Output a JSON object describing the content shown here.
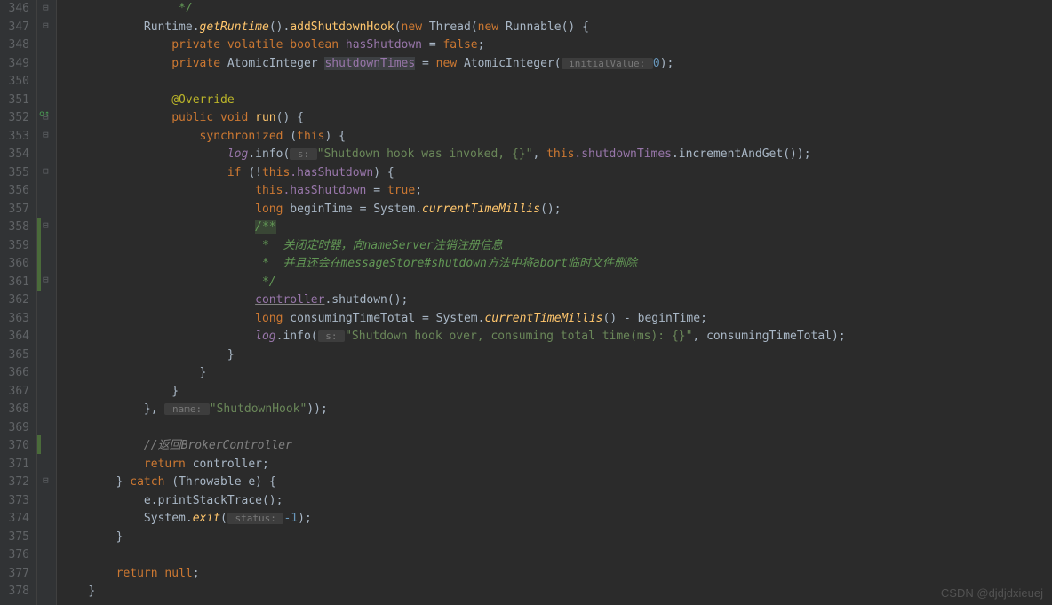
{
  "watermark": "CSDN @djdjdxieuej",
  "gutter": {
    "start": 346,
    "end": 378
  },
  "code": {
    "l346": {
      "indent": "                ",
      "c1": " */"
    },
    "l347": {
      "indent": "            ",
      "cls": "Runtime",
      "m1": "getRuntime",
      "m2": "addShutdownHook",
      "kw1": "new",
      "cls2": "Thread",
      "kw2": "new",
      "cls3": "Runnable",
      "end": "() {"
    },
    "l348": {
      "indent": "                ",
      "kw": "private volatile boolean ",
      "field": "hasShutdown",
      "op": " = ",
      "val": "false",
      "end": ";"
    },
    "l349": {
      "indent": "                ",
      "kw": "private ",
      "type": "AtomicInteger ",
      "field": "shutdownTimes",
      "op": " = ",
      "kw2": "new ",
      "cls": "AtomicInteger(",
      "hint": " initialValue: ",
      "val": "0",
      "end": ");"
    },
    "l350": {
      "indent": ""
    },
    "l351": {
      "indent": "                ",
      "annotation": "@Override"
    },
    "l352": {
      "indent": "                ",
      "kw": "public void ",
      "method": "run",
      "end": "() {"
    },
    "l353": {
      "indent": "                    ",
      "kw": "synchronized ",
      "p1": "(",
      "kw2": "this",
      "p2": ") {"
    },
    "l354": {
      "indent": "                        ",
      "var": "log",
      "m": ".info(",
      "hint": " s: ",
      "str": "\"Shutdown hook was invoked, {}\"",
      "c": ", ",
      "kw": "this",
      "f": ".shutdownTimes",
      "m2": ".incrementAndGet());"
    },
    "l355": {
      "indent": "                        ",
      "kw": "if ",
      "p1": "(!",
      "kw2": "this",
      "f": ".hasShutdown",
      "p2": ") {"
    },
    "l356": {
      "indent": "                            ",
      "kw": "this",
      "f": ".hasShutdown",
      "op": " = ",
      "val": "true",
      "end": ";"
    },
    "l357": {
      "indent": "                            ",
      "kw": "long ",
      "var": "beginTime = System.",
      "m": "currentTimeMillis",
      "end": "();"
    },
    "l358": {
      "indent": "                            ",
      "c": "/**"
    },
    "l359": {
      "indent": "                            ",
      "c": " *  关闭定时器，向nameServer注销注册信息"
    },
    "l360": {
      "indent": "                            ",
      "c": " *  并且还会在messageStore#shutdown方法中将abort临时文件删除"
    },
    "l361": {
      "indent": "                            ",
      "c": " */"
    },
    "l362": {
      "indent": "                            ",
      "var": "controller",
      "m": ".shutdown();"
    },
    "l363": {
      "indent": "                            ",
      "kw": "long ",
      "var": "consumingTimeTotal = System.",
      "m": "currentTimeMillis",
      "mid": "() - beginTime;"
    },
    "l364": {
      "indent": "                            ",
      "var": "log",
      "m": ".info(",
      "hint": " s: ",
      "str": "\"Shutdown hook over, consuming total time(ms): {}\"",
      "c": ", consumingTimeTotal);"
    },
    "l365": {
      "indent": "                        ",
      "c": "}"
    },
    "l366": {
      "indent": "                    ",
      "c": "}"
    },
    "l367": {
      "indent": "                ",
      "c": "}"
    },
    "l368": {
      "indent": "            ",
      "c": "}, ",
      "hint": " name: ",
      "str": "\"ShutdownHook\"",
      "end": "));"
    },
    "l369": {
      "indent": ""
    },
    "l370": {
      "indent": "            ",
      "c": "//返回BrokerController"
    },
    "l371": {
      "indent": "            ",
      "kw": "return ",
      "var": "controller;"
    },
    "l372": {
      "indent": "        ",
      "c1": "} ",
      "kw": "catch ",
      "c2": "(Throwable e) {"
    },
    "l373": {
      "indent": "            ",
      "c": "e.printStackTrace();"
    },
    "l374": {
      "indent": "            ",
      "cls": "System.",
      "m": "exit",
      "p": "(",
      "hint": " status: ",
      "val": "-1",
      "end": ");"
    },
    "l375": {
      "indent": "        ",
      "c": "}"
    },
    "l376": {
      "indent": ""
    },
    "l377": {
      "indent": "        ",
      "kw": "return null",
      "end": ";"
    },
    "l378": {
      "indent": "    ",
      "c": "}"
    }
  }
}
